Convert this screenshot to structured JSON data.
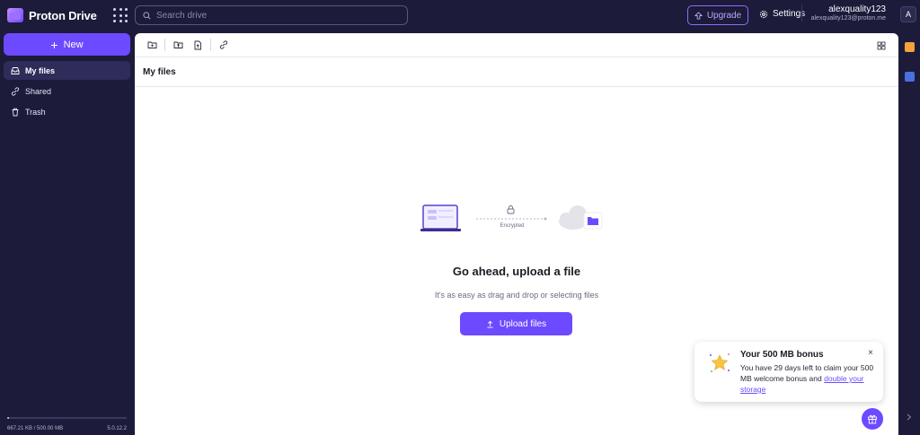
{
  "app": {
    "name": "Proton Drive"
  },
  "search": {
    "placeholder": "Search drive"
  },
  "header": {
    "upgrade_label": "Upgrade",
    "settings_label": "Settings",
    "user_name": "alexquality123",
    "user_email": "alexquality123@proton.me",
    "avatar_initial": "A"
  },
  "sidebar": {
    "new_label": "New",
    "items": [
      {
        "label": "My files",
        "icon": "inbox-icon",
        "active": true
      },
      {
        "label": "Shared",
        "icon": "link-icon",
        "active": false
      },
      {
        "label": "Trash",
        "icon": "trash-icon",
        "active": false
      }
    ],
    "storage": {
      "used": "667.21 KB",
      "separator": "/",
      "total": "500.00 MB",
      "fraction": 0.0013,
      "version": "5.0.12.2"
    }
  },
  "toolbar": {
    "icons": [
      "new-folder-icon",
      "upload-folder-icon",
      "upload-file-icon",
      "share-link-icon"
    ],
    "layout_icon": "grid-layout-icon"
  },
  "breadcrumb": {
    "title": "My files"
  },
  "empty_state": {
    "encrypted_label": "Encrypted",
    "title": "Go ahead, upload a file",
    "subtitle": "It's as easy as drag and drop or selecting files",
    "upload_label": "Upload files"
  },
  "toast": {
    "title": "Your 500 MB bonus",
    "body": "You have 29 days left to claim your 500 MB welcome bonus and",
    "link": "double your storage",
    "close": "×"
  },
  "colors": {
    "brand": "#6d4aff",
    "background": "#1c1b3a",
    "panel": "#ffffff"
  }
}
